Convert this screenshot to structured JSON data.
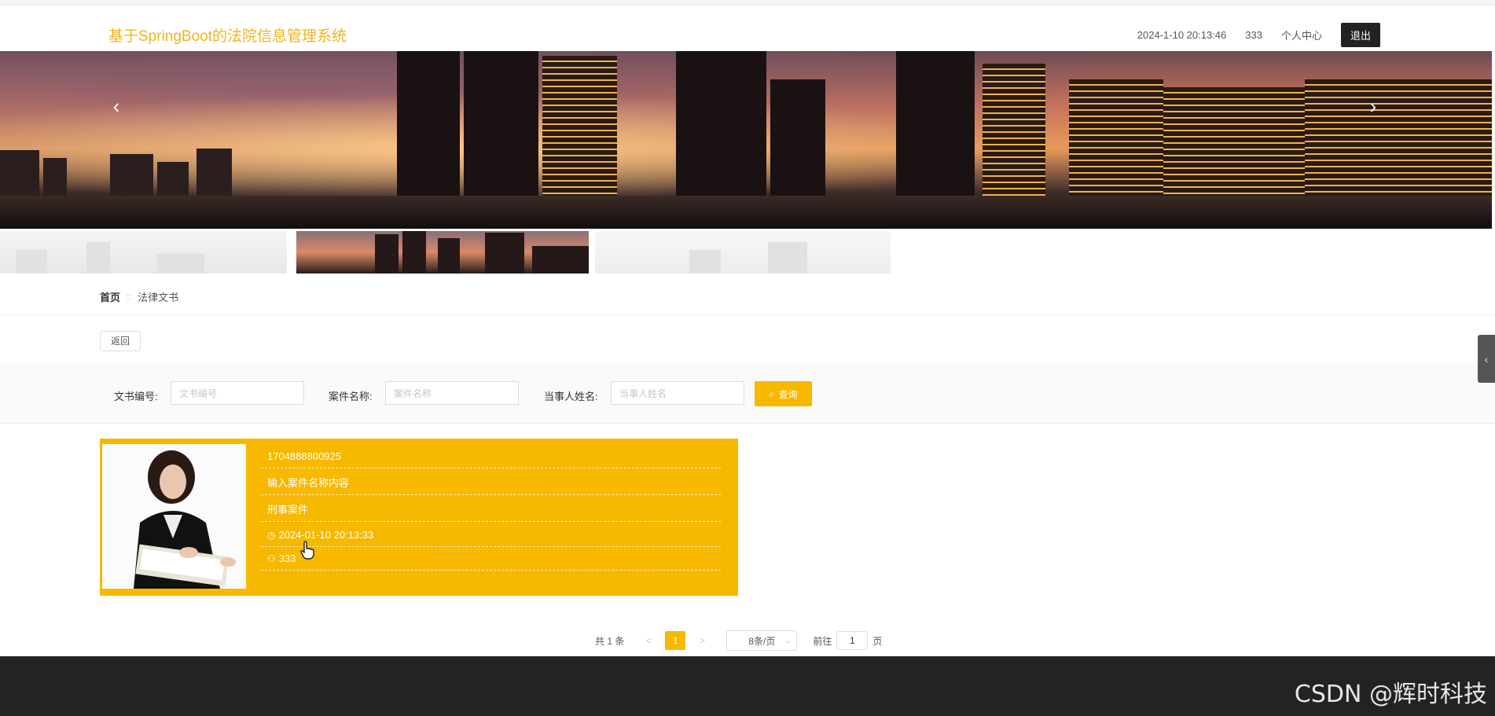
{
  "header": {
    "site_title": "基于SpringBoot的法院信息管理系统",
    "datetime": "2024-1-10 20:13:46",
    "username": "333",
    "personal_center": "个人中心",
    "logout": "退出"
  },
  "banner": {
    "prev_icon": "chevron-left-icon",
    "next_icon": "chevron-right-icon",
    "prev_glyph": "‹",
    "next_glyph": "›"
  },
  "breadcrumb": {
    "home": "首页",
    "separator": "::",
    "current": "法律文书"
  },
  "back_button": "返回",
  "search": {
    "doc_number_label": "文书编号:",
    "doc_number_placeholder": "文书编号",
    "case_name_label": "案件名称:",
    "case_name_placeholder": "案件名称",
    "party_name_label": "当事人姓名:",
    "party_name_placeholder": "当事人姓名",
    "button_label": "查询",
    "button_icon": "search-icon"
  },
  "side_handle_glyph": "‹",
  "cards": [
    {
      "doc_number": "1704888800925",
      "case_name": "输入案件名称内容",
      "case_type": "刑事案件",
      "time": "2024-01-10 20:13:33",
      "user": "333"
    }
  ],
  "pagination": {
    "total": "共 1 条",
    "prev": "<",
    "current_page": "1",
    "next": ">",
    "page_size": "8条/页",
    "goto_label": "前往",
    "goto_value": "1",
    "page_unit": "页"
  },
  "watermark": "CSDN @辉时科技",
  "colors": {
    "accent": "#f7b800",
    "title": "#f2b51a",
    "footer": "#232323"
  }
}
